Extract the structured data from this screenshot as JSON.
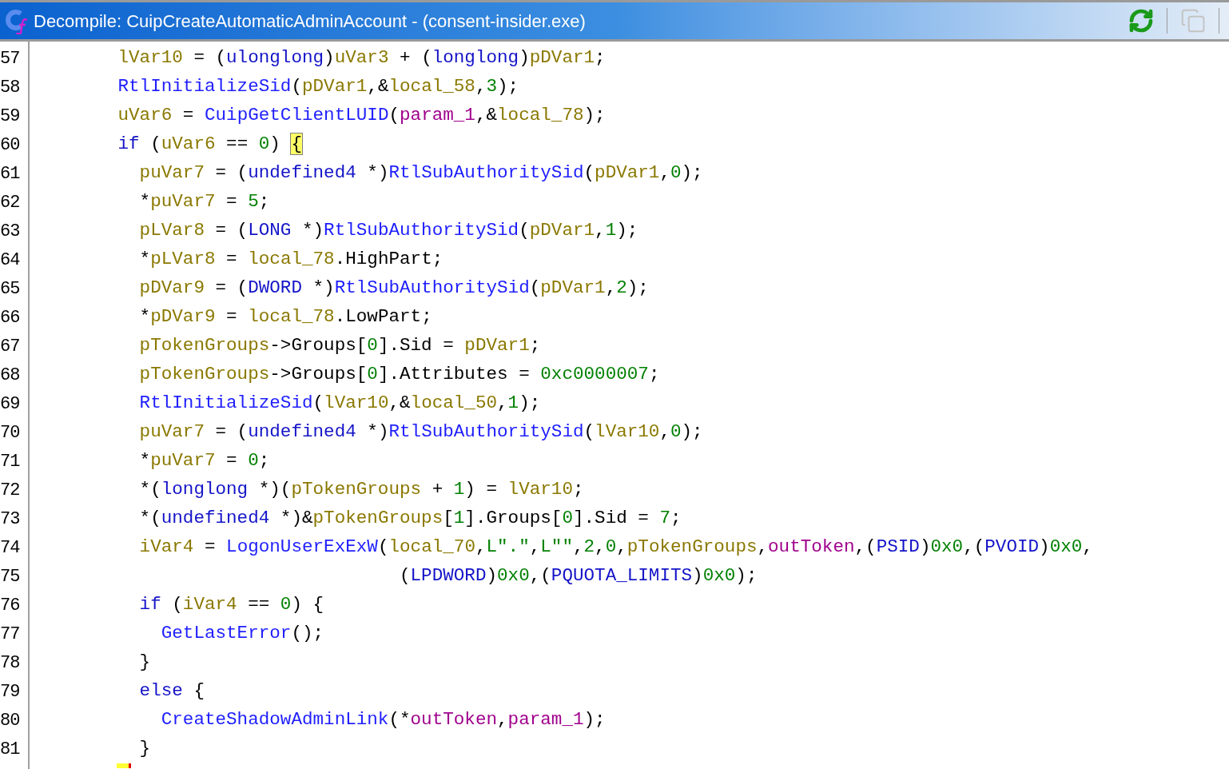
{
  "window": {
    "title": "Decompile: CuipCreateAutomaticAdminAccount -  (consent-insider.exe)"
  },
  "code_lines": [
    {
      "number": "57",
      "tokens": [
        {
          "kind": "var",
          "text": "        lVar10"
        },
        {
          "kind": "plain",
          "text": " = ("
        },
        {
          "kind": "type",
          "text": "ulonglong"
        },
        {
          "kind": "plain",
          "text": ")"
        },
        {
          "kind": "var",
          "text": "uVar3"
        },
        {
          "kind": "plain",
          "text": " + ("
        },
        {
          "kind": "type",
          "text": "longlong"
        },
        {
          "kind": "plain",
          "text": ")"
        },
        {
          "kind": "var",
          "text": "pDVar1"
        },
        {
          "kind": "plain",
          "text": ";"
        }
      ]
    },
    {
      "number": "58",
      "tokens": [
        {
          "kind": "fn",
          "text": "        RtlInitializeSid"
        },
        {
          "kind": "plain",
          "text": "("
        },
        {
          "kind": "var",
          "text": "pDVar1"
        },
        {
          "kind": "plain",
          "text": ",&"
        },
        {
          "kind": "var",
          "text": "local_58"
        },
        {
          "kind": "plain",
          "text": ","
        },
        {
          "kind": "const",
          "text": "3"
        },
        {
          "kind": "plain",
          "text": ");"
        }
      ]
    },
    {
      "number": "59",
      "tokens": [
        {
          "kind": "var",
          "text": "        uVar6"
        },
        {
          "kind": "plain",
          "text": " = "
        },
        {
          "kind": "fn",
          "text": "CuipGetClientLUID"
        },
        {
          "kind": "plain",
          "text": "("
        },
        {
          "kind": "param",
          "text": "param_1"
        },
        {
          "kind": "plain",
          "text": ",&"
        },
        {
          "kind": "var",
          "text": "local_78"
        },
        {
          "kind": "plain",
          "text": ");"
        }
      ]
    },
    {
      "number": "60",
      "tokens": [
        {
          "kind": "kw",
          "text": "        if"
        },
        {
          "kind": "plain",
          "text": " ("
        },
        {
          "kind": "var",
          "text": "uVar6"
        },
        {
          "kind": "plain",
          "text": " == "
        },
        {
          "kind": "const",
          "text": "0"
        },
        {
          "kind": "plain",
          "text": ") "
        },
        {
          "kind": "match",
          "text": "{"
        }
      ]
    },
    {
      "number": "61",
      "tokens": [
        {
          "kind": "var",
          "text": "          puVar7"
        },
        {
          "kind": "plain",
          "text": " = ("
        },
        {
          "kind": "type",
          "text": "undefined4"
        },
        {
          "kind": "plain",
          "text": " *)"
        },
        {
          "kind": "fn",
          "text": "RtlSubAuthoritySid"
        },
        {
          "kind": "plain",
          "text": "("
        },
        {
          "kind": "var",
          "text": "pDVar1"
        },
        {
          "kind": "plain",
          "text": ","
        },
        {
          "kind": "const",
          "text": "0"
        },
        {
          "kind": "plain",
          "text": ");"
        }
      ]
    },
    {
      "number": "62",
      "tokens": [
        {
          "kind": "plain",
          "text": "          *"
        },
        {
          "kind": "var",
          "text": "puVar7"
        },
        {
          "kind": "plain",
          "text": " = "
        },
        {
          "kind": "const",
          "text": "5"
        },
        {
          "kind": "plain",
          "text": ";"
        }
      ]
    },
    {
      "number": "63",
      "tokens": [
        {
          "kind": "var",
          "text": "          pLVar8"
        },
        {
          "kind": "plain",
          "text": " = ("
        },
        {
          "kind": "type",
          "text": "LONG"
        },
        {
          "kind": "plain",
          "text": " *)"
        },
        {
          "kind": "fn",
          "text": "RtlSubAuthoritySid"
        },
        {
          "kind": "plain",
          "text": "("
        },
        {
          "kind": "var",
          "text": "pDVar1"
        },
        {
          "kind": "plain",
          "text": ","
        },
        {
          "kind": "const",
          "text": "1"
        },
        {
          "kind": "plain",
          "text": ");"
        }
      ]
    },
    {
      "number": "64",
      "tokens": [
        {
          "kind": "plain",
          "text": "          *"
        },
        {
          "kind": "var",
          "text": "pLVar8"
        },
        {
          "kind": "plain",
          "text": " = "
        },
        {
          "kind": "var",
          "text": "local_78"
        },
        {
          "kind": "plain",
          "text": ".HighPart;"
        }
      ]
    },
    {
      "number": "65",
      "tokens": [
        {
          "kind": "var",
          "text": "          pDVar9"
        },
        {
          "kind": "plain",
          "text": " = ("
        },
        {
          "kind": "type",
          "text": "DWORD"
        },
        {
          "kind": "plain",
          "text": " *)"
        },
        {
          "kind": "fn",
          "text": "RtlSubAuthoritySid"
        },
        {
          "kind": "plain",
          "text": "("
        },
        {
          "kind": "var",
          "text": "pDVar1"
        },
        {
          "kind": "plain",
          "text": ","
        },
        {
          "kind": "const",
          "text": "2"
        },
        {
          "kind": "plain",
          "text": ");"
        }
      ]
    },
    {
      "number": "66",
      "tokens": [
        {
          "kind": "plain",
          "text": "          *"
        },
        {
          "kind": "var",
          "text": "pDVar9"
        },
        {
          "kind": "plain",
          "text": " = "
        },
        {
          "kind": "var",
          "text": "local_78"
        },
        {
          "kind": "plain",
          "text": ".LowPart;"
        }
      ]
    },
    {
      "number": "67",
      "tokens": [
        {
          "kind": "var",
          "text": "          pTokenGroups"
        },
        {
          "kind": "plain",
          "text": "->Groups["
        },
        {
          "kind": "const",
          "text": "0"
        },
        {
          "kind": "plain",
          "text": "].Sid = "
        },
        {
          "kind": "var",
          "text": "pDVar1"
        },
        {
          "kind": "plain",
          "text": ";"
        }
      ]
    },
    {
      "number": "68",
      "tokens": [
        {
          "kind": "var",
          "text": "          pTokenGroups"
        },
        {
          "kind": "plain",
          "text": "->Groups["
        },
        {
          "kind": "const",
          "text": "0"
        },
        {
          "kind": "plain",
          "text": "].Attributes = "
        },
        {
          "kind": "const",
          "text": "0xc0000007"
        },
        {
          "kind": "plain",
          "text": ";"
        }
      ]
    },
    {
      "number": "69",
      "tokens": [
        {
          "kind": "fn",
          "text": "          RtlInitializeSid"
        },
        {
          "kind": "plain",
          "text": "("
        },
        {
          "kind": "var",
          "text": "lVar10"
        },
        {
          "kind": "plain",
          "text": ",&"
        },
        {
          "kind": "var",
          "text": "local_50"
        },
        {
          "kind": "plain",
          "text": ","
        },
        {
          "kind": "const",
          "text": "1"
        },
        {
          "kind": "plain",
          "text": ");"
        }
      ]
    },
    {
      "number": "70",
      "tokens": [
        {
          "kind": "var",
          "text": "          puVar7"
        },
        {
          "kind": "plain",
          "text": " = ("
        },
        {
          "kind": "type",
          "text": "undefined4"
        },
        {
          "kind": "plain",
          "text": " *)"
        },
        {
          "kind": "fn",
          "text": "RtlSubAuthoritySid"
        },
        {
          "kind": "plain",
          "text": "("
        },
        {
          "kind": "var",
          "text": "lVar10"
        },
        {
          "kind": "plain",
          "text": ","
        },
        {
          "kind": "const",
          "text": "0"
        },
        {
          "kind": "plain",
          "text": ");"
        }
      ]
    },
    {
      "number": "71",
      "tokens": [
        {
          "kind": "plain",
          "text": "          *"
        },
        {
          "kind": "var",
          "text": "puVar7"
        },
        {
          "kind": "plain",
          "text": " = "
        },
        {
          "kind": "const",
          "text": "0"
        },
        {
          "kind": "plain",
          "text": ";"
        }
      ]
    },
    {
      "number": "72",
      "tokens": [
        {
          "kind": "plain",
          "text": "          *("
        },
        {
          "kind": "type",
          "text": "longlong"
        },
        {
          "kind": "plain",
          "text": " *)("
        },
        {
          "kind": "var",
          "text": "pTokenGroups"
        },
        {
          "kind": "plain",
          "text": " + "
        },
        {
          "kind": "const",
          "text": "1"
        },
        {
          "kind": "plain",
          "text": ") = "
        },
        {
          "kind": "var",
          "text": "lVar10"
        },
        {
          "kind": "plain",
          "text": ";"
        }
      ]
    },
    {
      "number": "73",
      "tokens": [
        {
          "kind": "plain",
          "text": "          *("
        },
        {
          "kind": "type",
          "text": "undefined4"
        },
        {
          "kind": "plain",
          "text": " *)&"
        },
        {
          "kind": "var",
          "text": "pTokenGroups"
        },
        {
          "kind": "plain",
          "text": "["
        },
        {
          "kind": "const",
          "text": "1"
        },
        {
          "kind": "plain",
          "text": "].Groups["
        },
        {
          "kind": "const",
          "text": "0"
        },
        {
          "kind": "plain",
          "text": "].Sid = "
        },
        {
          "kind": "const",
          "text": "7"
        },
        {
          "kind": "plain",
          "text": ";"
        }
      ]
    },
    {
      "number": "74",
      "tokens": [
        {
          "kind": "var",
          "text": "          iVar4"
        },
        {
          "kind": "plain",
          "text": " = "
        },
        {
          "kind": "fn",
          "text": "LogonUserExExW"
        },
        {
          "kind": "plain",
          "text": "("
        },
        {
          "kind": "var",
          "text": "local_70"
        },
        {
          "kind": "plain",
          "text": ","
        },
        {
          "kind": "const",
          "text": "L\".\""
        },
        {
          "kind": "plain",
          "text": ","
        },
        {
          "kind": "const",
          "text": "L\"\""
        },
        {
          "kind": "plain",
          "text": ","
        },
        {
          "kind": "const",
          "text": "2"
        },
        {
          "kind": "plain",
          "text": ","
        },
        {
          "kind": "const",
          "text": "0"
        },
        {
          "kind": "plain",
          "text": ","
        },
        {
          "kind": "var",
          "text": "pTokenGroups"
        },
        {
          "kind": "plain",
          "text": ","
        },
        {
          "kind": "param",
          "text": "outToken"
        },
        {
          "kind": "plain",
          "text": ",("
        },
        {
          "kind": "type",
          "text": "PSID"
        },
        {
          "kind": "plain",
          "text": ")"
        },
        {
          "kind": "const",
          "text": "0x0"
        },
        {
          "kind": "plain",
          "text": ",("
        },
        {
          "kind": "type",
          "text": "PVOID"
        },
        {
          "kind": "plain",
          "text": ")"
        },
        {
          "kind": "const",
          "text": "0x0"
        },
        {
          "kind": "plain",
          "text": ","
        }
      ]
    },
    {
      "number": "75",
      "tokens": [
        {
          "kind": "plain",
          "text": "                                  ("
        },
        {
          "kind": "type",
          "text": "LPDWORD"
        },
        {
          "kind": "plain",
          "text": ")"
        },
        {
          "kind": "const",
          "text": "0x0"
        },
        {
          "kind": "plain",
          "text": ",("
        },
        {
          "kind": "type",
          "text": "PQUOTA_LIMITS"
        },
        {
          "kind": "plain",
          "text": ")"
        },
        {
          "kind": "const",
          "text": "0x0"
        },
        {
          "kind": "plain",
          "text": ");"
        }
      ]
    },
    {
      "number": "76",
      "tokens": [
        {
          "kind": "kw",
          "text": "          if"
        },
        {
          "kind": "plain",
          "text": " ("
        },
        {
          "kind": "var",
          "text": "iVar4"
        },
        {
          "kind": "plain",
          "text": " == "
        },
        {
          "kind": "const",
          "text": "0"
        },
        {
          "kind": "plain",
          "text": ") {"
        }
      ]
    },
    {
      "number": "77",
      "tokens": [
        {
          "kind": "fn",
          "text": "            GetLastError"
        },
        {
          "kind": "plain",
          "text": "();"
        }
      ]
    },
    {
      "number": "78",
      "tokens": [
        {
          "kind": "plain",
          "text": "          }"
        }
      ]
    },
    {
      "number": "79",
      "tokens": [
        {
          "kind": "kw",
          "text": "          else"
        },
        {
          "kind": "plain",
          "text": " {"
        }
      ]
    },
    {
      "number": "80",
      "tokens": [
        {
          "kind": "fn",
          "text": "            CreateShadowAdminLink"
        },
        {
          "kind": "plain",
          "text": "(*"
        },
        {
          "kind": "param",
          "text": "outToken"
        },
        {
          "kind": "plain",
          "text": ","
        },
        {
          "kind": "param",
          "text": "param_1"
        },
        {
          "kind": "plain",
          "text": ");"
        }
      ]
    },
    {
      "number": "81",
      "tokens": [
        {
          "kind": "plain",
          "text": "          }"
        }
      ]
    }
  ]
}
